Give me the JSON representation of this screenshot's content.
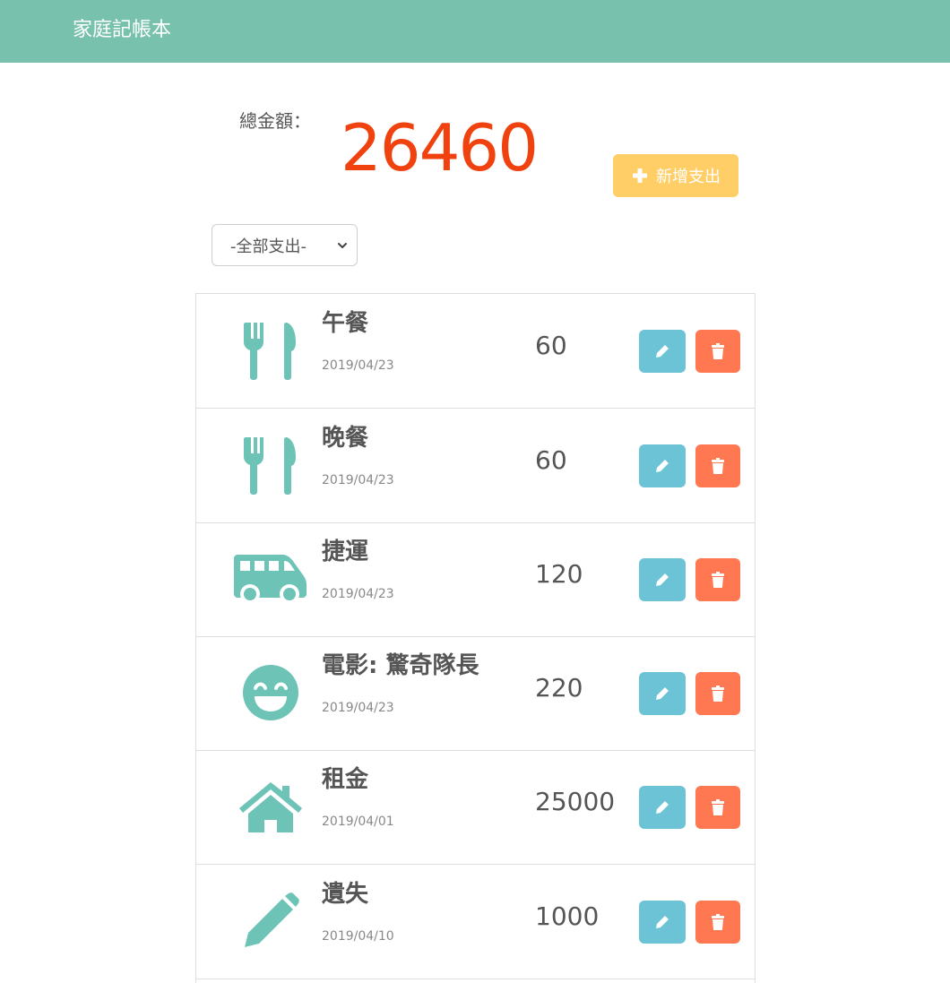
{
  "header": {
    "brand": "家庭記帳本"
  },
  "summary": {
    "total_label": "總金額：",
    "total_amount": "26460",
    "add_button_label": "新增支出"
  },
  "filter": {
    "selected": "-全部支出-"
  },
  "colors": {
    "navbar": "#78c2ad",
    "total": "#f0420f",
    "add_button": "#ffce67",
    "icon": "#6cc3b6",
    "edit_button": "#6cc3d5",
    "delete_button": "#ff7851"
  },
  "expenses": [
    {
      "icon": "utensils-icon",
      "title": "午餐",
      "date": "2019/04/23",
      "amount": "60"
    },
    {
      "icon": "utensils-icon",
      "title": "晚餐",
      "date": "2019/04/23",
      "amount": "60"
    },
    {
      "icon": "bus-icon",
      "title": "捷運",
      "date": "2019/04/23",
      "amount": "120"
    },
    {
      "icon": "smile-icon",
      "title": "電影: 驚奇隊長",
      "date": "2019/04/23",
      "amount": "220"
    },
    {
      "icon": "home-icon",
      "title": "租金",
      "date": "2019/04/01",
      "amount": "25000"
    },
    {
      "icon": "pencil-icon",
      "title": "遺失",
      "date": "2019/04/10",
      "amount": "1000"
    }
  ]
}
